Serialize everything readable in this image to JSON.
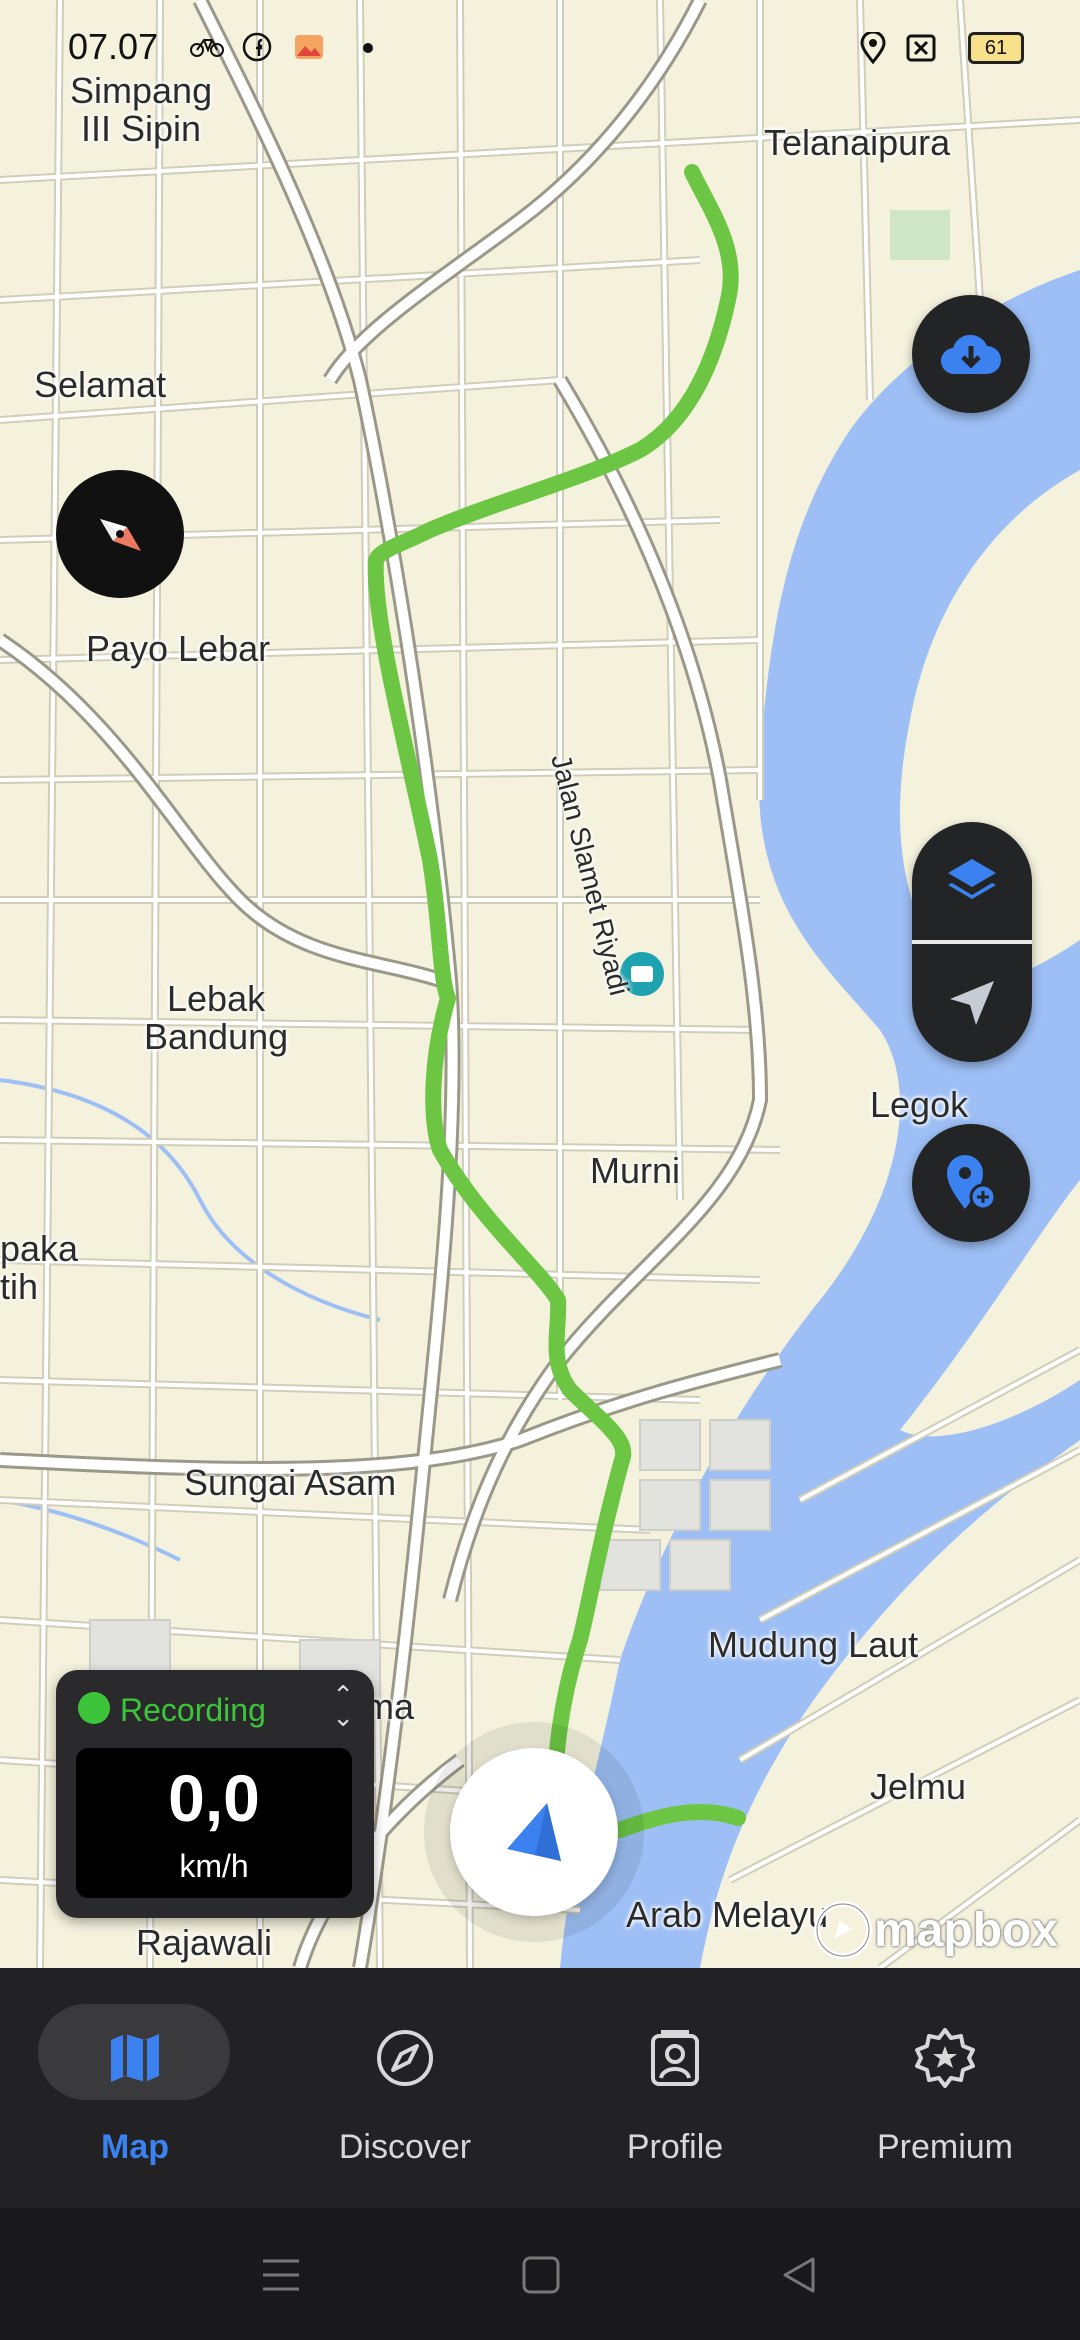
{
  "status_bar": {
    "time": "07.07",
    "battery": "61",
    "icons": [
      "bike-icon",
      "facebook-icon",
      "gallery-icon",
      "dot-icon",
      "location-icon",
      "no-sim-icon",
      "battery-icon"
    ]
  },
  "map": {
    "places": [
      {
        "id": "simpang",
        "text": "Simpang\nIII Sipin"
      },
      {
        "id": "telanaipura",
        "text": "Telanaipura"
      },
      {
        "id": "selamat",
        "text": "Selamat"
      },
      {
        "id": "payo",
        "text": "Payo Lebar"
      },
      {
        "id": "lebak",
        "text": "Lebak\nBandung"
      },
      {
        "id": "murni",
        "text": "Murni"
      },
      {
        "id": "legok",
        "text": "Legok"
      },
      {
        "id": "paka",
        "text": "paka\ntih"
      },
      {
        "id": "sungai",
        "text": "Sungai Asam"
      },
      {
        "id": "mudung",
        "text": "Mudung Laut"
      },
      {
        "id": "jelmu",
        "text": "Jelmu"
      },
      {
        "id": "arab",
        "text": "Arab Melayu"
      },
      {
        "id": "rajawali",
        "text": "Rajawali"
      },
      {
        "id": "ma",
        "text": "ma"
      }
    ],
    "street_label": "Jalan Slamet Riyadi",
    "route_color": "#6cc644",
    "water_color": "#9dbff5",
    "attribution": "mapbox"
  },
  "recording": {
    "label": "Recording",
    "speed": "0,0",
    "unit": "km/h",
    "dot_color": "#3cc43a"
  },
  "tabs": [
    {
      "label": "Map",
      "icon": "map-icon",
      "active": true
    },
    {
      "label": "Discover",
      "icon": "compass-icon",
      "active": false
    },
    {
      "label": "Profile",
      "icon": "profile-icon",
      "active": false
    },
    {
      "label": "Premium",
      "icon": "premium-star-icon",
      "active": false
    }
  ],
  "accent_color": "#3b82f0"
}
